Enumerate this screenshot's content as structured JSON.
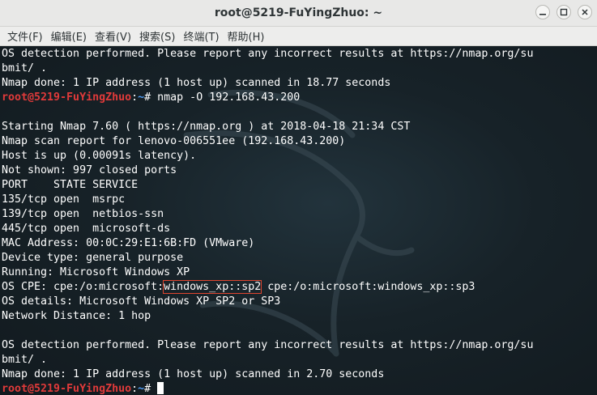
{
  "window": {
    "title": "root@5219-FuYingZhuo: ~"
  },
  "menu": [
    "文件(F)",
    "编辑(E)",
    "查看(V)",
    "搜索(S)",
    "终端(T)",
    "帮助(H)"
  ],
  "terminal": {
    "top": [
      "OS detection performed. Please report any incorrect results at https://nmap.org/su",
      "bmit/ .",
      "Nmap done: 1 IP address (1 host up) scanned in 18.77 seconds"
    ],
    "prompt": {
      "user": "root@5219-FuYingZhuo",
      "sep": ":",
      "path": "~",
      "symbol": "# ",
      "command": "nmap -O 192.168.43.200"
    },
    "output1": [
      "",
      "Starting Nmap 7.60 ( https://nmap.org ) at 2018-04-18 21:34 CST",
      "Nmap scan report for lenovo-006551ee (192.168.43.200)",
      "Host is up (0.00091s latency).",
      "Not shown: 997 closed ports",
      "PORT    STATE SERVICE",
      "135/tcp open  msrpc",
      "139/tcp open  netbios-ssn",
      "445/tcp open  microsoft-ds",
      "MAC Address: 00:0C:29:E1:6B:FD (VMware)",
      "Device type: general purpose",
      "Running: Microsoft Windows XP"
    ],
    "cpe": {
      "prefix": "OS CPE: cpe:/o:microsoft:",
      "highlight": "windows_xp::sp2",
      "suffix": " cpe:/o:microsoft:windows_xp::sp3"
    },
    "output2": [
      "OS details: Microsoft Windows XP SP2 or SP3",
      "Network Distance: 1 hop",
      "",
      "OS detection performed. Please report any incorrect results at https://nmap.org/su",
      "bmit/ .",
      "Nmap done: 1 IP address (1 host up) scanned in 2.70 seconds"
    ],
    "final_prompt": {
      "user": "root@5219-FuYingZhuo",
      "sep": ":",
      "path": "~",
      "symbol": "# "
    }
  }
}
